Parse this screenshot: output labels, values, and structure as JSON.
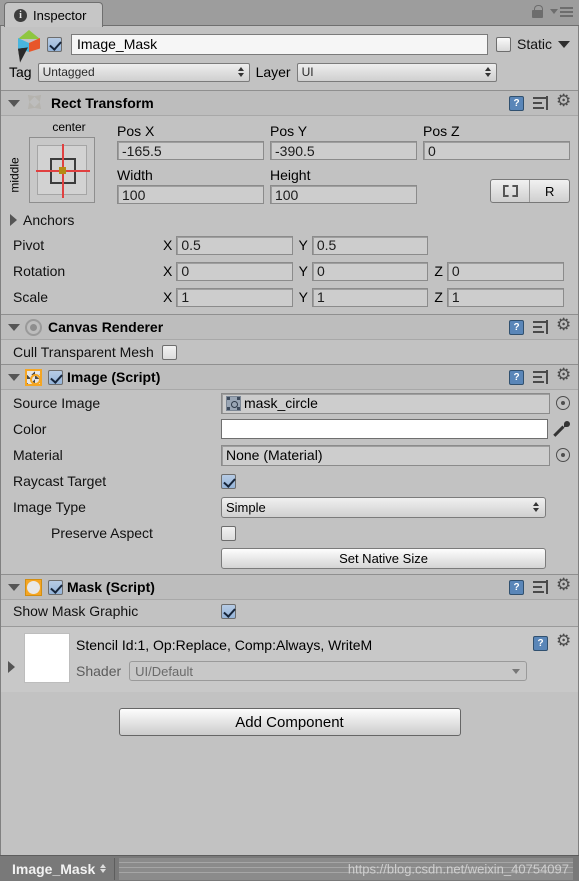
{
  "window": {
    "tab_label": "Inspector",
    "info_icon": "info-icon",
    "lock_icon": "lock-icon",
    "menu_icon": "hamburger-menu-icon"
  },
  "object_header": {
    "name_value": "Image_Mask",
    "enabled": true,
    "static_label": "Static",
    "static_checked": false,
    "tag_label": "Tag",
    "tag_value": "Untagged",
    "layer_label": "Layer",
    "layer_value": "UI"
  },
  "rect_transform": {
    "title": "Rect Transform",
    "anchor_preset": {
      "horizontal": "center",
      "vertical": "middle"
    },
    "pos_x_label": "Pos X",
    "pos_y_label": "Pos Y",
    "pos_z_label": "Pos Z",
    "pos_x": "-165.5",
    "pos_y": "-390.5",
    "pos_z": "0",
    "width_label": "Width",
    "height_label": "Height",
    "width": "100",
    "height": "100",
    "blueprint_label": "",
    "raw_label": "R",
    "anchors_label": "Anchors",
    "pivot_label": "Pivot",
    "pivot_x": "0.5",
    "pivot_y": "0.5",
    "rotation_label": "Rotation",
    "rotation_x": "0",
    "rotation_y": "0",
    "rotation_z": "0",
    "scale_label": "Scale",
    "scale_x": "1",
    "scale_y": "1",
    "scale_z": "1",
    "axis_x": "X",
    "axis_y": "Y",
    "axis_z": "Z"
  },
  "canvas_renderer": {
    "title": "Canvas Renderer",
    "cull_label": "Cull Transparent Mesh",
    "cull_checked": false
  },
  "image_component": {
    "title": "Image (Script)",
    "enabled": true,
    "source_image_label": "Source Image",
    "source_image_value": "mask_circle",
    "color_label": "Color",
    "color_value": "#FFFFFF",
    "material_label": "Material",
    "material_value": "None (Material)",
    "raycast_label": "Raycast Target",
    "raycast_checked": true,
    "image_type_label": "Image Type",
    "image_type_value": "Simple",
    "preserve_aspect_label": "Preserve Aspect",
    "preserve_aspect_checked": false,
    "set_native_size_label": "Set Native Size"
  },
  "mask_component": {
    "title": "Mask (Script)",
    "enabled": true,
    "show_mask_graphic_label": "Show Mask Graphic",
    "show_mask_graphic_checked": true
  },
  "material_block": {
    "name": "Stencil Id:1, Op:Replace, Comp:Always, WriteM",
    "shader_label": "Shader",
    "shader_value": "UI/Default"
  },
  "add_component": {
    "label": "Add Component"
  },
  "footer": {
    "breadcrumb": "Image_Mask",
    "watermark": "https://blog.csdn.net/weixin_40754097"
  },
  "colors": {
    "panel_bg": "#c2c2c2",
    "accent_orange": "#f5a623",
    "checkbox_blue": "#96b5da",
    "anchor_red": "#e04040"
  }
}
